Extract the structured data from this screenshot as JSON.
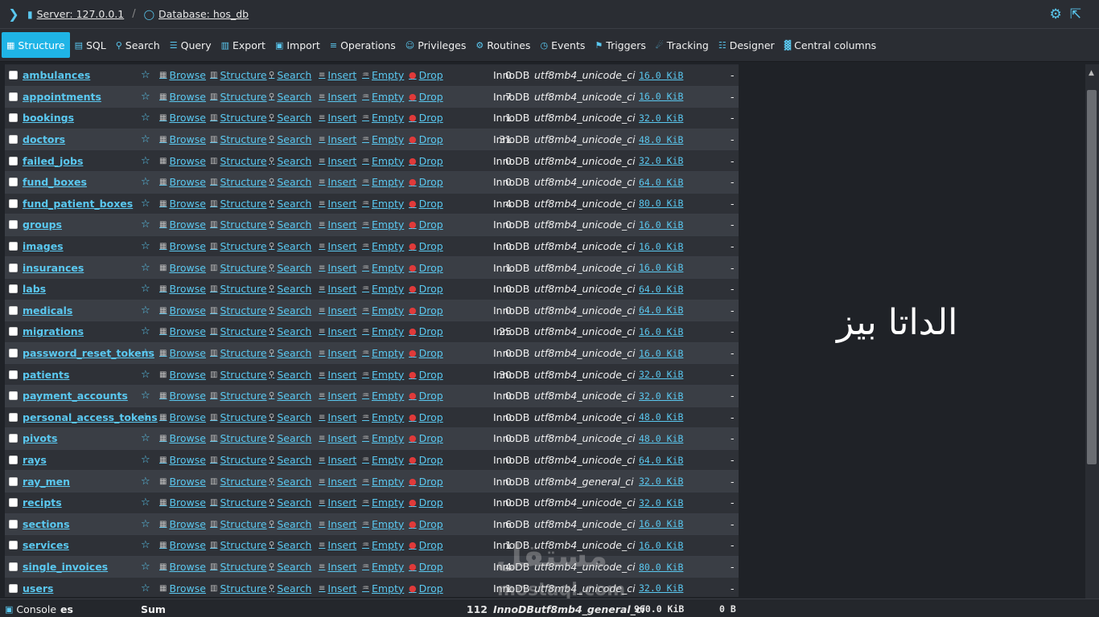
{
  "topbar": {
    "server_label": "Server: 127.0.0.1",
    "database_label": "Database: hos_db"
  },
  "menu": [
    {
      "label": "Structure",
      "icon": "table-icon",
      "active": true
    },
    {
      "label": "SQL",
      "icon": "sql-icon"
    },
    {
      "label": "Search",
      "icon": "search-icon"
    },
    {
      "label": "Query",
      "icon": "query-icon"
    },
    {
      "label": "Export",
      "icon": "export-icon"
    },
    {
      "label": "Import",
      "icon": "import-icon"
    },
    {
      "label": "Operations",
      "icon": "operations-icon"
    },
    {
      "label": "Privileges",
      "icon": "privileges-icon"
    },
    {
      "label": "Routines",
      "icon": "routines-icon"
    },
    {
      "label": "Events",
      "icon": "events-icon"
    },
    {
      "label": "Triggers",
      "icon": "triggers-icon"
    },
    {
      "label": "Tracking",
      "icon": "tracking-icon"
    },
    {
      "label": "Designer",
      "icon": "designer-icon"
    },
    {
      "label": "Central columns",
      "icon": "central-columns-icon"
    }
  ],
  "actions": {
    "browse": "Browse",
    "structure": "Structure",
    "search": "Search",
    "insert": "Insert",
    "empty": "Empty",
    "drop": "Drop"
  },
  "tables": [
    {
      "name": "ambulances",
      "rows": "0",
      "engine": "InnoDB",
      "collation": "utf8mb4_unicode_ci",
      "size": "16.0 KiB",
      "overhead": "-"
    },
    {
      "name": "appointments",
      "rows": "7",
      "engine": "InnoDB",
      "collation": "utf8mb4_unicode_ci",
      "size": "16.0 KiB",
      "overhead": "-"
    },
    {
      "name": "bookings",
      "rows": "1",
      "engine": "InnoDB",
      "collation": "utf8mb4_unicode_ci",
      "size": "32.0 KiB",
      "overhead": "-"
    },
    {
      "name": "doctors",
      "rows": "31",
      "engine": "InnoDB",
      "collation": "utf8mb4_unicode_ci",
      "size": "48.0 KiB",
      "overhead": "-"
    },
    {
      "name": "failed_jobs",
      "rows": "0",
      "engine": "InnoDB",
      "collation": "utf8mb4_unicode_ci",
      "size": "32.0 KiB",
      "overhead": "-"
    },
    {
      "name": "fund_boxes",
      "rows": "0",
      "engine": "InnoDB",
      "collation": "utf8mb4_unicode_ci",
      "size": "64.0 KiB",
      "overhead": "-"
    },
    {
      "name": "fund_patient_boxes",
      "rows": "4",
      "engine": "InnoDB",
      "collation": "utf8mb4_unicode_ci",
      "size": "80.0 KiB",
      "overhead": "-"
    },
    {
      "name": "groups",
      "rows": "0",
      "engine": "InnoDB",
      "collation": "utf8mb4_unicode_ci",
      "size": "16.0 KiB",
      "overhead": "-"
    },
    {
      "name": "images",
      "rows": "0",
      "engine": "InnoDB",
      "collation": "utf8mb4_unicode_ci",
      "size": "16.0 KiB",
      "overhead": "-"
    },
    {
      "name": "insurances",
      "rows": "1",
      "engine": "InnoDB",
      "collation": "utf8mb4_unicode_ci",
      "size": "16.0 KiB",
      "overhead": "-"
    },
    {
      "name": "labs",
      "rows": "0",
      "engine": "InnoDB",
      "collation": "utf8mb4_unicode_ci",
      "size": "64.0 KiB",
      "overhead": "-"
    },
    {
      "name": "medicals",
      "rows": "0",
      "engine": "InnoDB",
      "collation": "utf8mb4_unicode_ci",
      "size": "64.0 KiB",
      "overhead": "-"
    },
    {
      "name": "migrations",
      "rows": "25",
      "engine": "InnoDB",
      "collation": "utf8mb4_unicode_ci",
      "size": "16.0 KiB",
      "overhead": "-"
    },
    {
      "name": "password_reset_tokens",
      "rows": "0",
      "engine": "InnoDB",
      "collation": "utf8mb4_unicode_ci",
      "size": "16.0 KiB",
      "overhead": "-"
    },
    {
      "name": "patients",
      "rows": "30",
      "engine": "InnoDB",
      "collation": "utf8mb4_unicode_ci",
      "size": "32.0 KiB",
      "overhead": "-"
    },
    {
      "name": "payment_accounts",
      "rows": "0",
      "engine": "InnoDB",
      "collation": "utf8mb4_unicode_ci",
      "size": "32.0 KiB",
      "overhead": "-"
    },
    {
      "name": "personal_access_tokens",
      "rows": "0",
      "engine": "InnoDB",
      "collation": "utf8mb4_unicode_ci",
      "size": "48.0 KiB",
      "overhead": "-"
    },
    {
      "name": "pivots",
      "rows": "0",
      "engine": "InnoDB",
      "collation": "utf8mb4_unicode_ci",
      "size": "48.0 KiB",
      "overhead": "-"
    },
    {
      "name": "rays",
      "rows": "0",
      "engine": "InnoDB",
      "collation": "utf8mb4_unicode_ci",
      "size": "64.0 KiB",
      "overhead": "-"
    },
    {
      "name": "ray_men",
      "rows": "0",
      "engine": "InnoDB",
      "collation": "utf8mb4_general_ci",
      "size": "32.0 KiB",
      "overhead": "-"
    },
    {
      "name": "recipts",
      "rows": "0",
      "engine": "InnoDB",
      "collation": "utf8mb4_unicode_ci",
      "size": "32.0 KiB",
      "overhead": "-"
    },
    {
      "name": "sections",
      "rows": "6",
      "engine": "InnoDB",
      "collation": "utf8mb4_unicode_ci",
      "size": "16.0 KiB",
      "overhead": "-"
    },
    {
      "name": "services",
      "rows": "1",
      "engine": "InnoDB",
      "collation": "utf8mb4_unicode_ci",
      "size": "16.0 KiB",
      "overhead": "-"
    },
    {
      "name": "single_invoices",
      "rows": "4",
      "engine": "InnoDB",
      "collation": "utf8mb4_unicode_ci",
      "size": "80.0 KiB",
      "overhead": "-"
    },
    {
      "name": "users",
      "rows": "1",
      "engine": "InnoDB",
      "collation": "utf8mb4_unicode_ci",
      "size": "32.0 KiB",
      "overhead": "-"
    }
  ],
  "footer": {
    "console_label": "Console",
    "console_suffix": "es",
    "sum_label": "Sum",
    "sum_rows": "112",
    "sum_engine": "InnoDB",
    "sum_collation": "utf8mb4_general_ci",
    "sum_size": "960.0 KiB",
    "sum_overhead": "0 B"
  },
  "overlay": {
    "arabic_title": "الداتا بيز",
    "watermark_arabic": "مستقل",
    "watermark_url": "mostaql.com"
  },
  "colors": {
    "accent": "#1fb4e6",
    "link": "#5ac8f0",
    "drop": "#e03a3a",
    "background": "#1f2227"
  }
}
